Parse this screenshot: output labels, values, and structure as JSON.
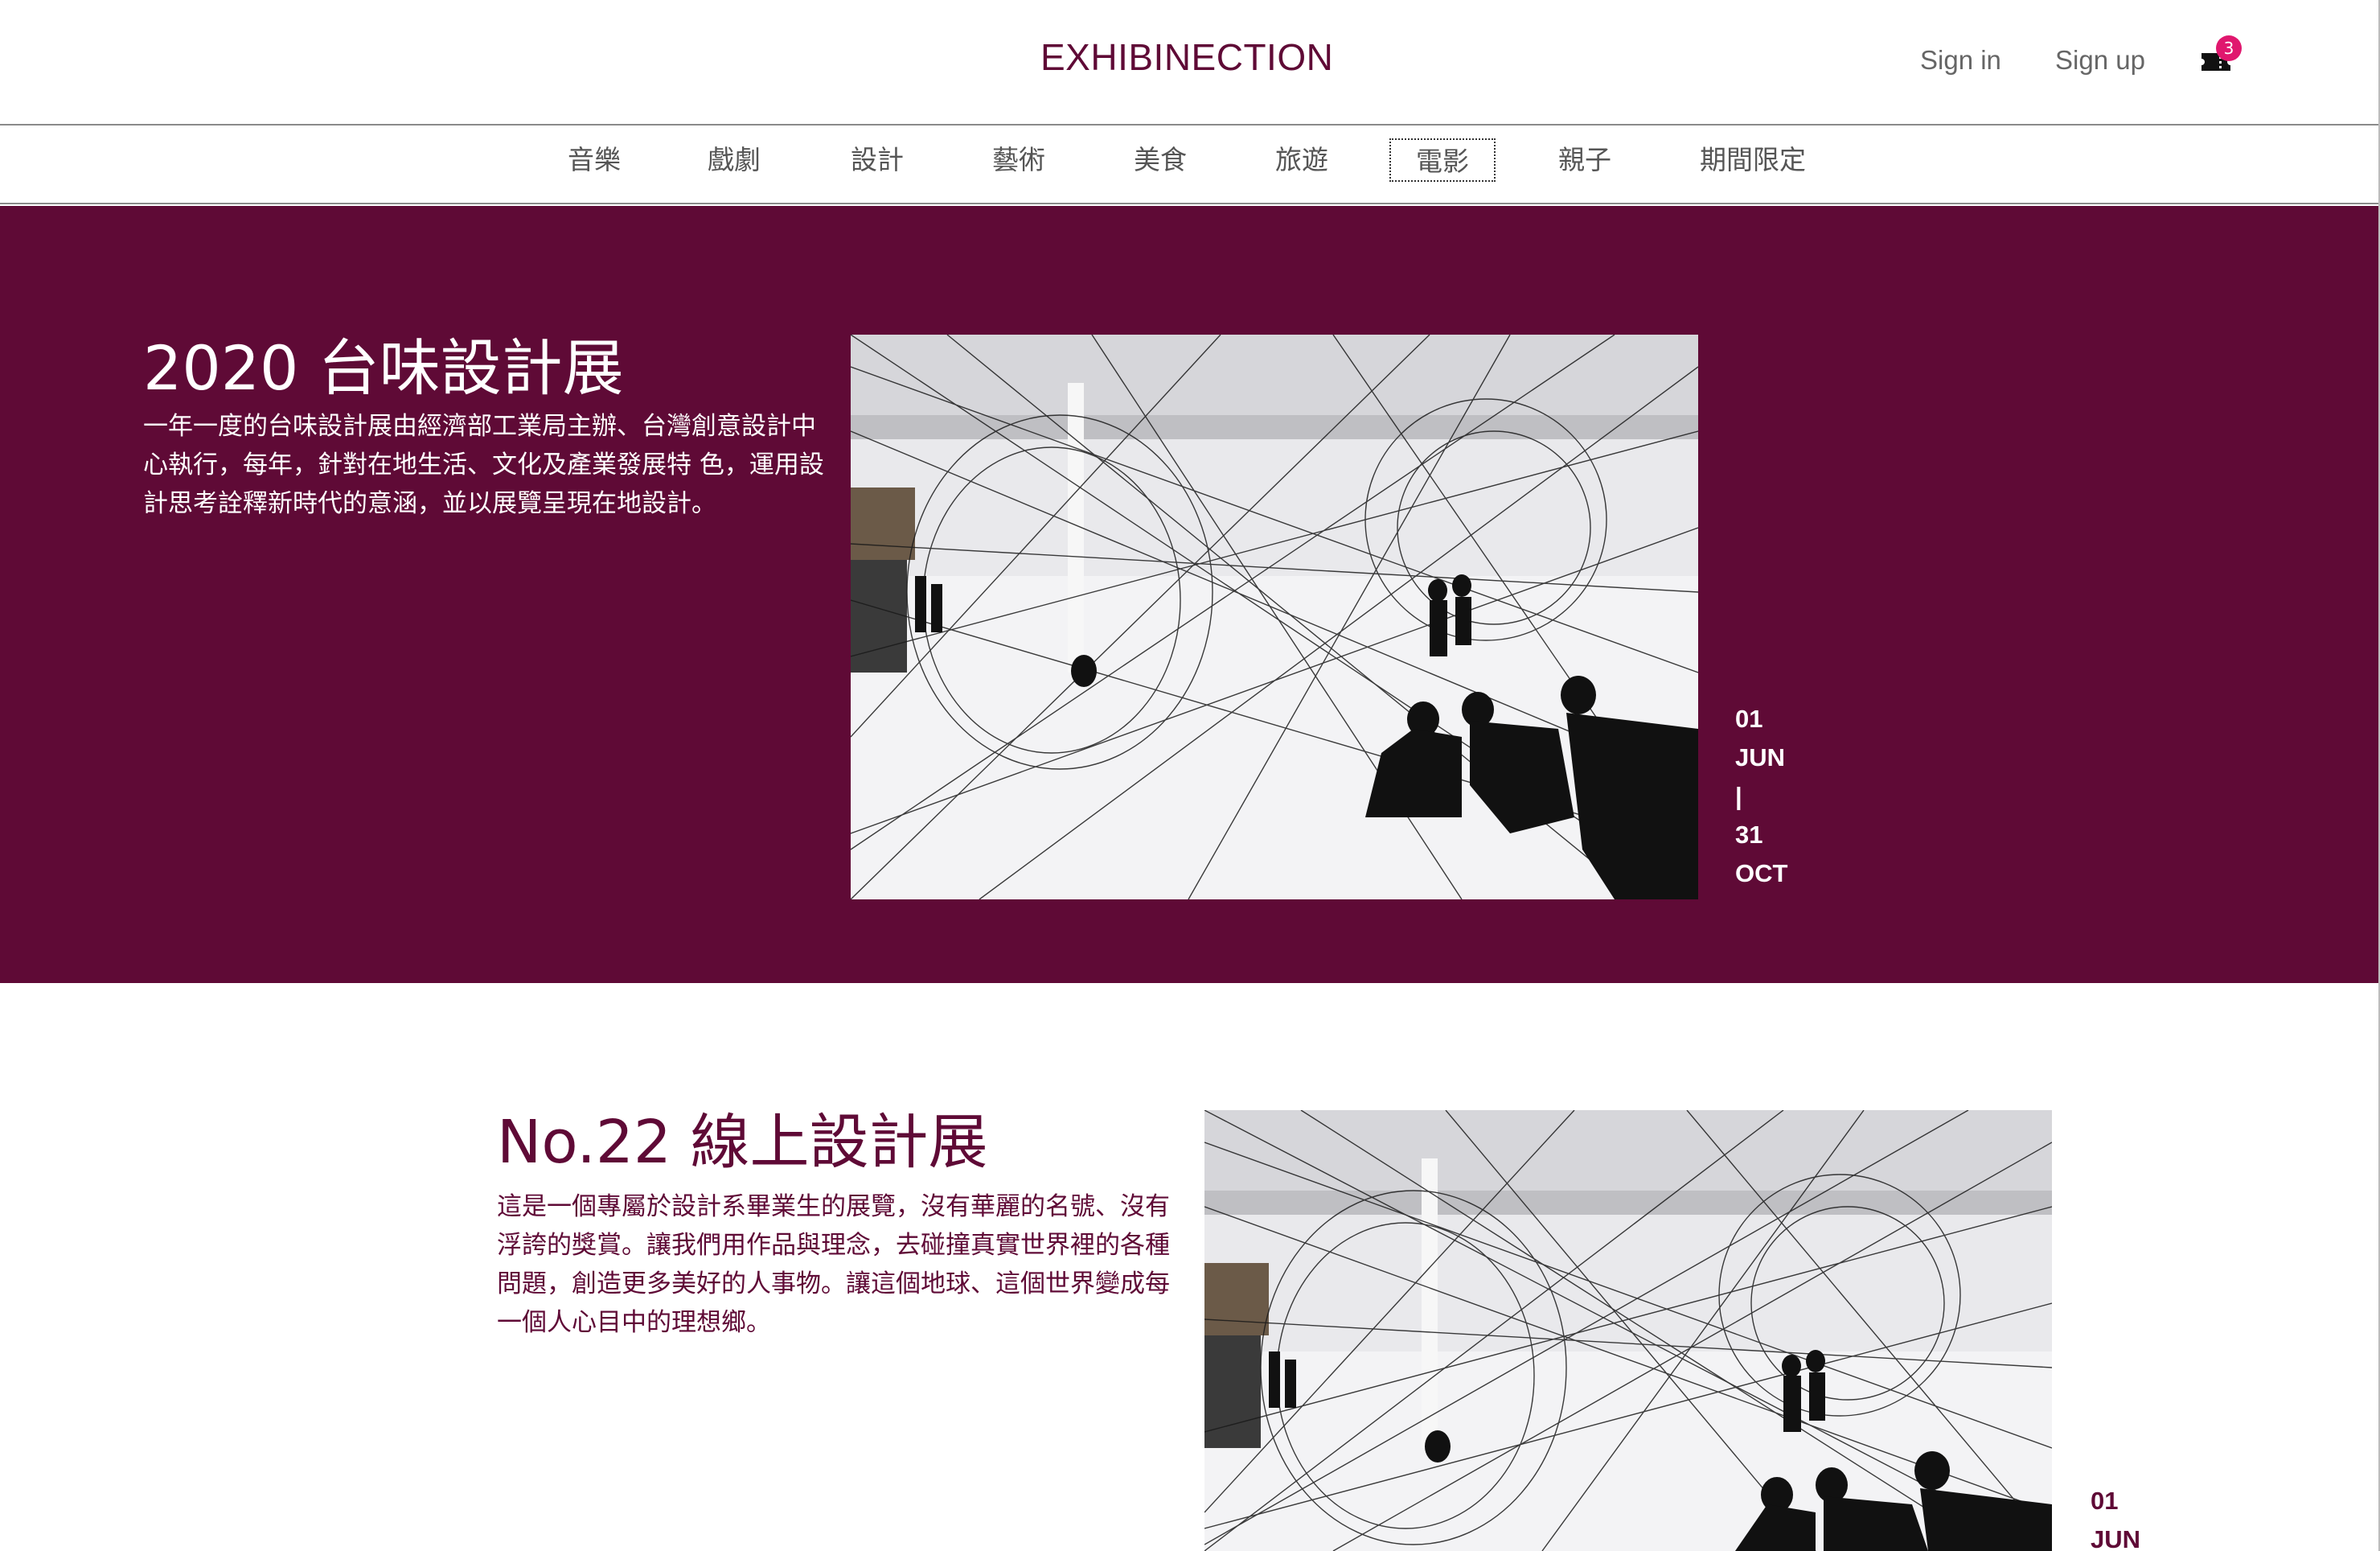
{
  "header": {
    "logo": "EXHIBINECTION",
    "sign_in": "Sign in",
    "sign_up": "Sign up",
    "cart_count": "3",
    "cart_icon": "ticket-icon"
  },
  "nav": {
    "items": [
      {
        "label": "音樂"
      },
      {
        "label": "戲劇"
      },
      {
        "label": "設計"
      },
      {
        "label": "藝術"
      },
      {
        "label": "美食"
      },
      {
        "label": "旅遊"
      },
      {
        "label": "電影"
      },
      {
        "label": "親子"
      },
      {
        "label": "期間限定"
      }
    ],
    "active_label": "電影"
  },
  "hero": {
    "title": "2020 台味設計展",
    "description": "一年一度的台味設計展由經濟部工業局主辦、台灣創意設計中心執行，每年，針對在地生活、文化及產業發展特 色，運用設計思考詮釋新時代的意涵，並以展覽呈現在地設計。",
    "dates": {
      "start_day": "01",
      "start_month": "JUN",
      "separator": "|",
      "end_day": "31",
      "end_month": "OCT"
    }
  },
  "exhibition": {
    "title": "No.22 線上設計展",
    "description": "這是一個專屬於設計系畢業生的展覽，沒有華麗的名號、沒有浮誇的獎賞。讓我們用作品與理念，去碰撞真實世界裡的各種問題，創造更多美好的人事物。讓這個地球、這個世界變成每一個人心目中的理想鄉。",
    "dates": {
      "start_day": "01",
      "start_month": "JUN"
    }
  },
  "colors": {
    "brand": "#5f0a36",
    "badge": "#e0176e",
    "nav_text": "#555555"
  }
}
